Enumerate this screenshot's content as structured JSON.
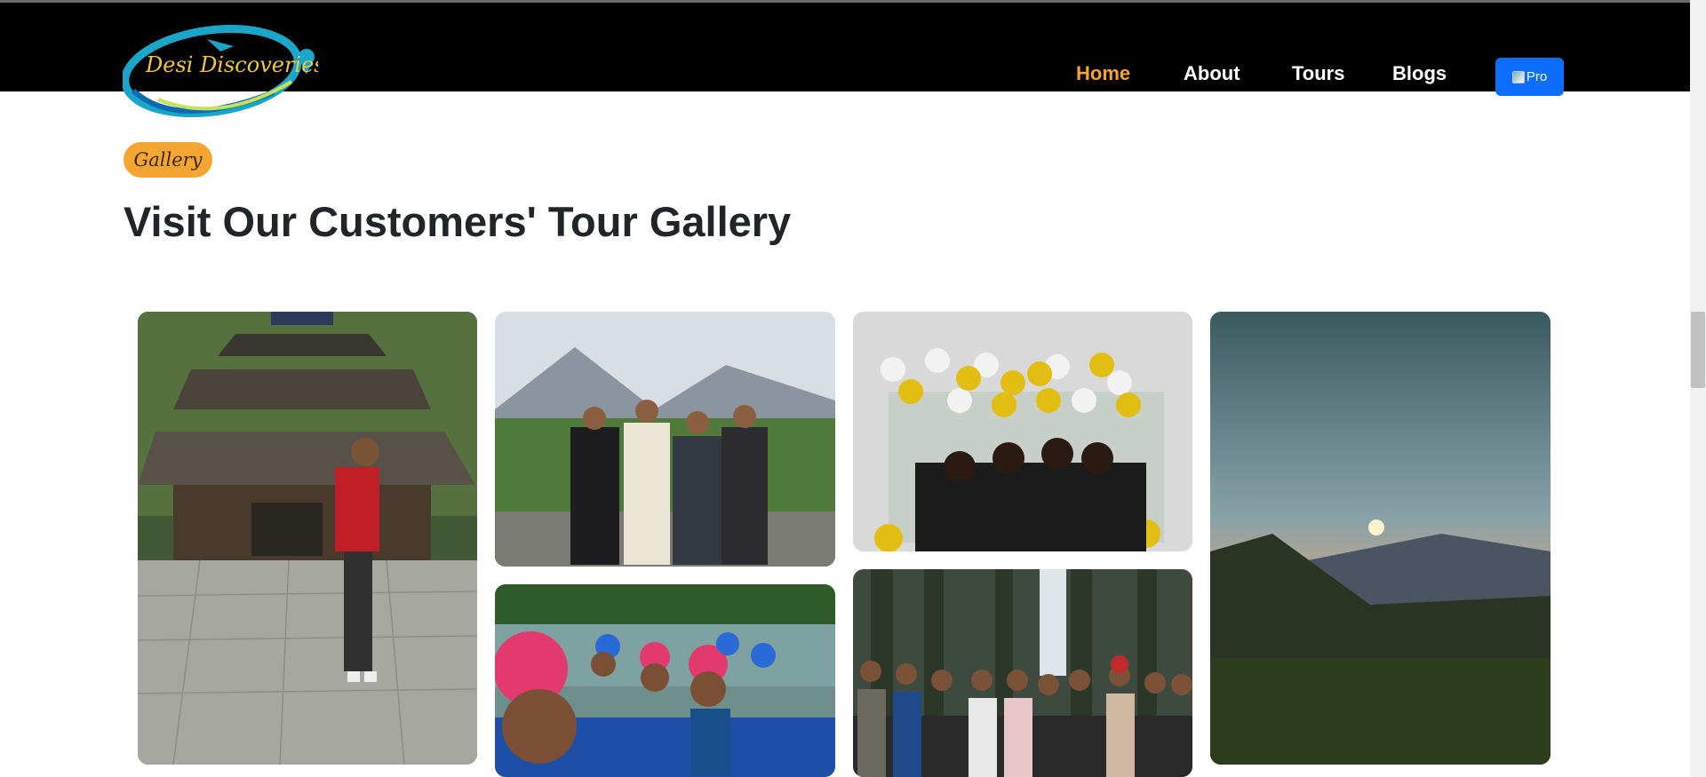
{
  "brand": {
    "name": "Desi Discoveries"
  },
  "nav": {
    "items": [
      {
        "label": "Home",
        "active": true
      },
      {
        "label": "About",
        "active": false
      },
      {
        "label": "Tours",
        "active": false
      },
      {
        "label": "Blogs",
        "active": false
      }
    ],
    "profile_alt": "Pro"
  },
  "section": {
    "badge": "Gallery",
    "title": "Visit Our Customers' Tour Gallery"
  },
  "gallery": [
    {
      "name": "temple-photo",
      "subject": "man-at-wooden-temple"
    },
    {
      "name": "group-mountains-photo",
      "subject": "four-friends-mountains"
    },
    {
      "name": "balloon-party-photo",
      "subject": "friends-balloon-party"
    },
    {
      "name": "sunset-valley-photo",
      "subject": "sunset-over-valley"
    },
    {
      "name": "river-rafting-photo",
      "subject": "rafting-selfie"
    },
    {
      "name": "forest-group-photo",
      "subject": "group-in-pine-forest"
    }
  ],
  "colors": {
    "accent": "#f5a531",
    "primary": "#0d6efd",
    "nav_bg": "#000000",
    "text": "#212529"
  }
}
